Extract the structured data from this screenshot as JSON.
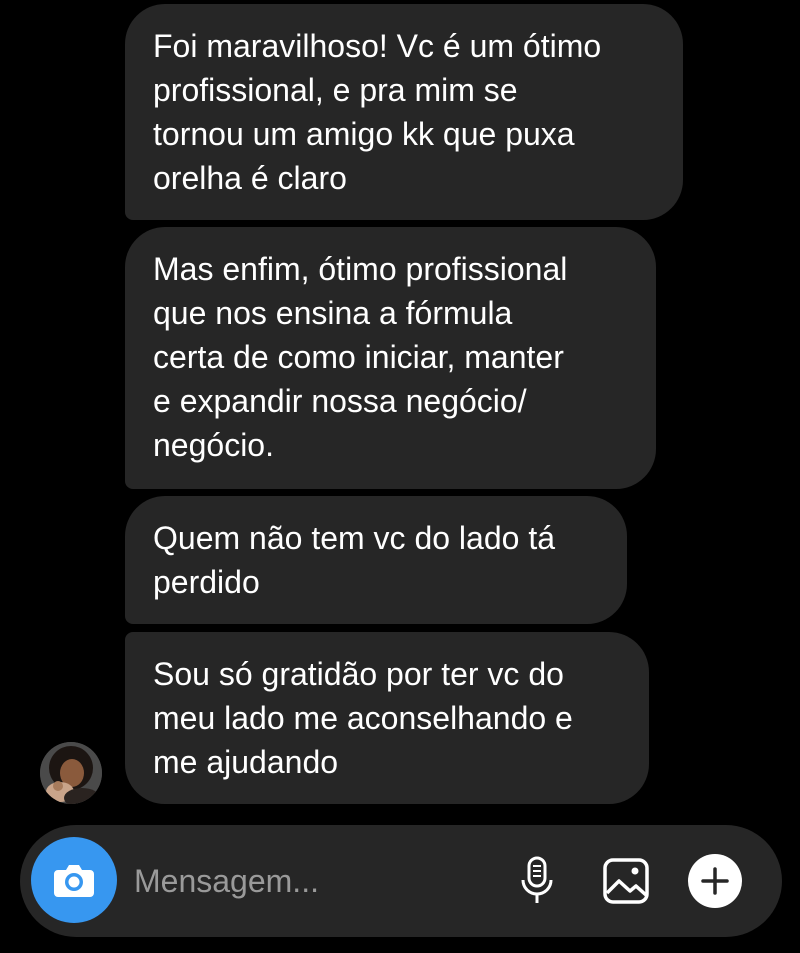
{
  "messages": [
    {
      "text": "Foi maravilhoso! Vc é um ótimo\nprofissional, e pra mim se\ntornou um amigo kk que puxa\norelha é claro"
    },
    {
      "text": "Mas enfim, ótimo profissional\nque nos ensina a fórmula\ncerta de como iniciar, manter\ne expandir nossa negócio/\nnegócio."
    },
    {
      "text": "Quem não tem vc do lado tá\nperdido"
    },
    {
      "text": "Sou só gratidão por ter vc do\nmeu lado me aconselhando e\nme ajudando"
    }
  ],
  "composer": {
    "placeholder": "Mensagem...",
    "icons": {
      "camera": "camera-icon",
      "mic": "microphone-icon",
      "gallery": "image-icon",
      "plus": "plus-icon"
    }
  },
  "colors": {
    "background": "#000000",
    "bubble": "#262626",
    "text": "#ffffff",
    "accent": "#3797f0",
    "placeholder": "#9a9a9a"
  }
}
